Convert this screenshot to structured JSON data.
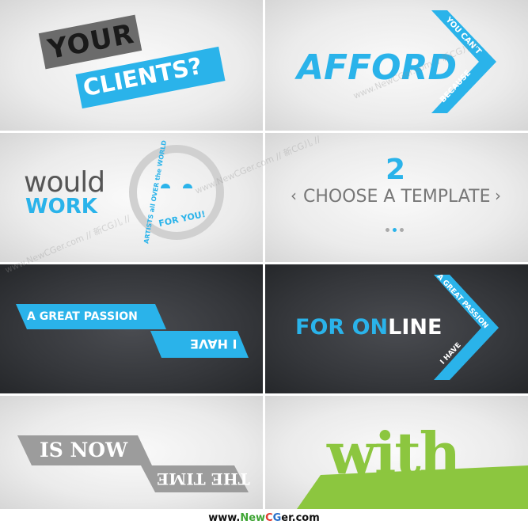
{
  "panel1": {
    "line1": "YOUR",
    "line2": "CLIENTS?"
  },
  "panel2": {
    "main": "AFFORD",
    "arrow_top": "YOU CAN'T",
    "arrow_bottom": "BECAUSE"
  },
  "panel3": {
    "word1": "would",
    "word2": "WORK",
    "ring_text": "ARTISTS all OVER the WORLD",
    "inner": "FOR YOU!"
  },
  "panel4": {
    "number": "2",
    "label": "CHOOSE A TEMPLATE",
    "left_chevron": "‹",
    "right_chevron": "›"
  },
  "panel5": {
    "bar1": "A GREAT PASSION",
    "bar2": "I HAVE"
  },
  "panel6": {
    "main_part1": "FOR ON",
    "main_part2": "LINE",
    "arrow_top": "A GREAT PASSION",
    "arrow_bottom": "I HAVE"
  },
  "panel7": {
    "bar1": "IS NOW",
    "bar2": "THE TIME"
  },
  "panel8": {
    "word": "with"
  },
  "watermark": {
    "text": "www.NewCGer.com // 新CG儿 //"
  },
  "footer": {
    "site_prefix": "www.",
    "site_new": "New",
    "site_c": "C",
    "site_g": "G",
    "site_suffix": "er.com"
  },
  "colors": {
    "blue": "#2ab3ea",
    "grey": "#6b6b6b",
    "light_grey": "#9c9c9c",
    "green": "#8cc63f",
    "dark_bg": "#35373b"
  }
}
